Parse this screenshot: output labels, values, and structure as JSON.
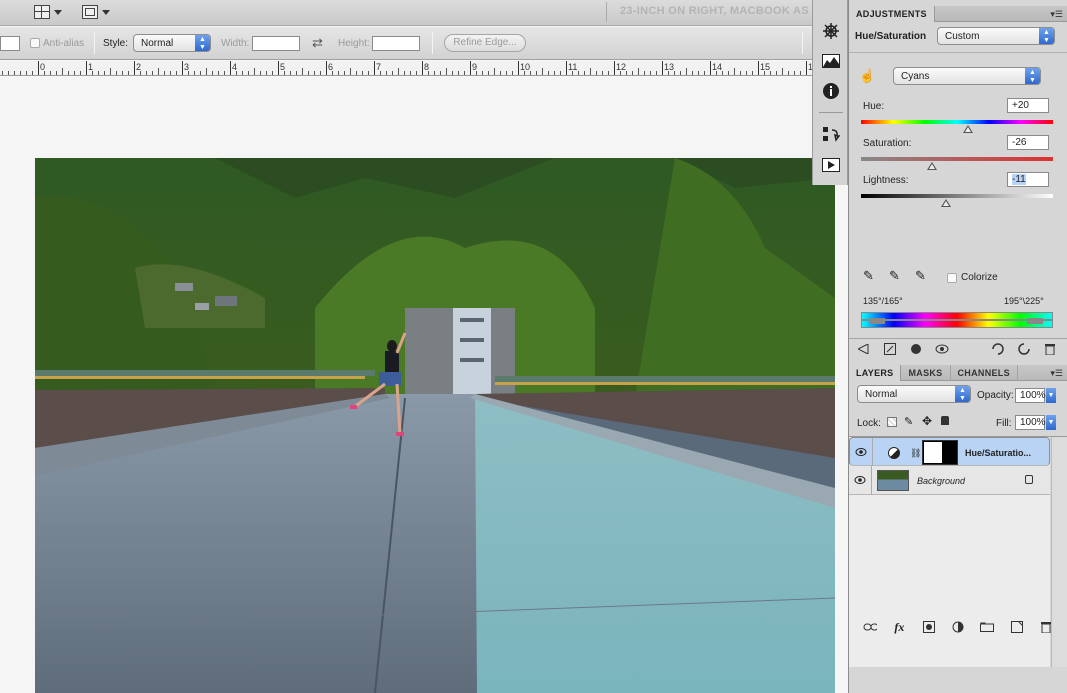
{
  "app_bar": {
    "document_title": "23-INCH ON RIGHT, MACBOOK AS",
    "buttons": [
      {
        "name": "arrange-documents-button",
        "icon": "layout-grid-icon"
      },
      {
        "name": "screen-mode-button",
        "icon": "screen-mode-icon"
      }
    ]
  },
  "options_bar": {
    "feather_value": "",
    "anti_alias_label": "Anti-alias",
    "style_label": "Style:",
    "style_value": "Normal",
    "width_label": "Width:",
    "width_value": "",
    "swap_icon": "swap-arrows-icon",
    "height_label": "Height:",
    "height_value": "",
    "refine_edge_label": "Refine Edge..."
  },
  "ruler": {
    "labels": [
      "0",
      "1",
      "2",
      "3",
      "4",
      "5",
      "6",
      "7",
      "8",
      "9",
      "10",
      "11",
      "12",
      "13",
      "14",
      "15",
      "16"
    ]
  },
  "dock": {
    "icons": [
      "navigator-wheel-icon",
      "histogram-icon",
      "info-icon",
      "history-icon",
      "actions-play-icon"
    ]
  },
  "adjustments": {
    "tab_label": "ADJUSTMENTS",
    "type_label": "Hue/Saturation",
    "preset_value": "Custom",
    "channel_value": "Cyans",
    "hue_label": "Hue:",
    "hue_value": "+20",
    "hue_position": 0.556,
    "saturation_label": "Saturation:",
    "saturation_value": "-26",
    "saturation_position": 0.37,
    "lightness_label": "Lightness:",
    "lightness_value": "-11",
    "lightness_position": 0.445,
    "colorize_label": "Colorize",
    "colorize_checked": false,
    "range_left": "135°/165°",
    "range_right": "195°\\225°",
    "bottom_icons": [
      "back-arrow-icon",
      "expand-view-icon",
      "clip-to-layer-icon",
      "visibility-eye-icon",
      "view-previous-icon",
      "reset-icon",
      "trash-icon"
    ]
  },
  "layers": {
    "tabs": [
      "LAYERS",
      "MASKS",
      "CHANNELS"
    ],
    "blend_mode": "Normal",
    "opacity_label": "Opacity:",
    "opacity_value": "100%",
    "lock_label": "Lock:",
    "fill_label": "Fill:",
    "fill_value": "100%",
    "items": [
      {
        "name": "Hue/Saturatio...",
        "type": "adjustment",
        "visible": true,
        "selected": true
      },
      {
        "name": "Background",
        "type": "image",
        "visible": true,
        "selected": false,
        "locked": true
      }
    ],
    "bottom_icons": [
      "link-icon",
      "fx-icon",
      "mask-icon",
      "adjustment-layer-icon",
      "group-folder-icon",
      "new-layer-icon",
      "trash-icon"
    ]
  },
  "colors": {
    "panel_bg": "#d6d6d6",
    "selection_blue": "#b9d3f5",
    "accent_blue": "#2f68cf"
  }
}
